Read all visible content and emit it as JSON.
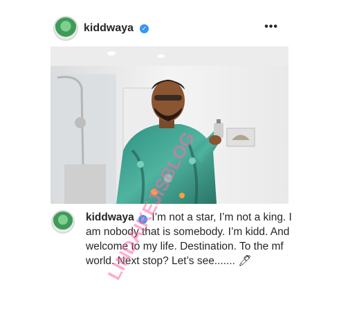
{
  "post": {
    "username": "kiddwaya",
    "verified_icon": "verified-badge-icon",
    "more_icon": "more-options-icon",
    "more_label": "•••"
  },
  "caption": {
    "username": "kiddwaya",
    "text": "I’m not a star, I’m not a king. I am nobody that is somebody. I’m kidd. And welcome to my life. Destination. To the mf world. Next stop? Let’s see....... 🖊"
  },
  "watermark": {
    "text": "LINDAIKEJISBLOG"
  },
  "colors": {
    "verified": "#3897f0",
    "text": "#262626",
    "watermark": "#ff6aa8"
  }
}
